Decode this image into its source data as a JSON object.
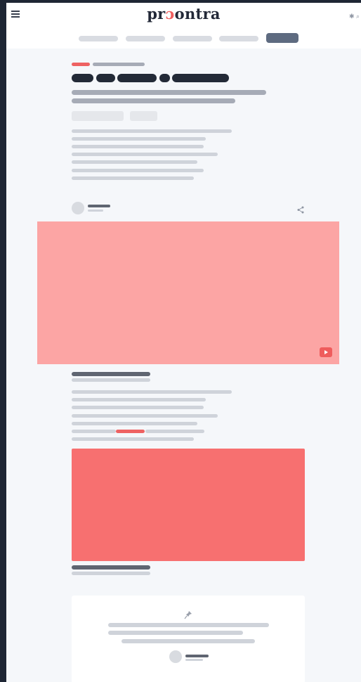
{
  "header": {
    "brand_prefix": "pr",
    "brand_accent": "ɔ",
    "brand_suffix": "ontra",
    "right_glyph": "✱ ⌕"
  },
  "nav": {
    "items": [
      "",
      "",
      "",
      "",
      ""
    ],
    "active_index": 4
  },
  "icons": {
    "menu": "hamburger-menu-icon",
    "share": "share-icon",
    "play": "play-icon",
    "quote": "pin-icon"
  },
  "colors": {
    "page_bg": "#f5f7fa",
    "header_bg": "#ffffff",
    "brand": "#222837",
    "accent": "#ee6262",
    "video_placeholder": "#fca5a4",
    "image_placeholder": "#f77070",
    "text_skeleton": "#cfd3da",
    "title_skeleton": "#232a37",
    "nav_active": "#5e6b80"
  }
}
